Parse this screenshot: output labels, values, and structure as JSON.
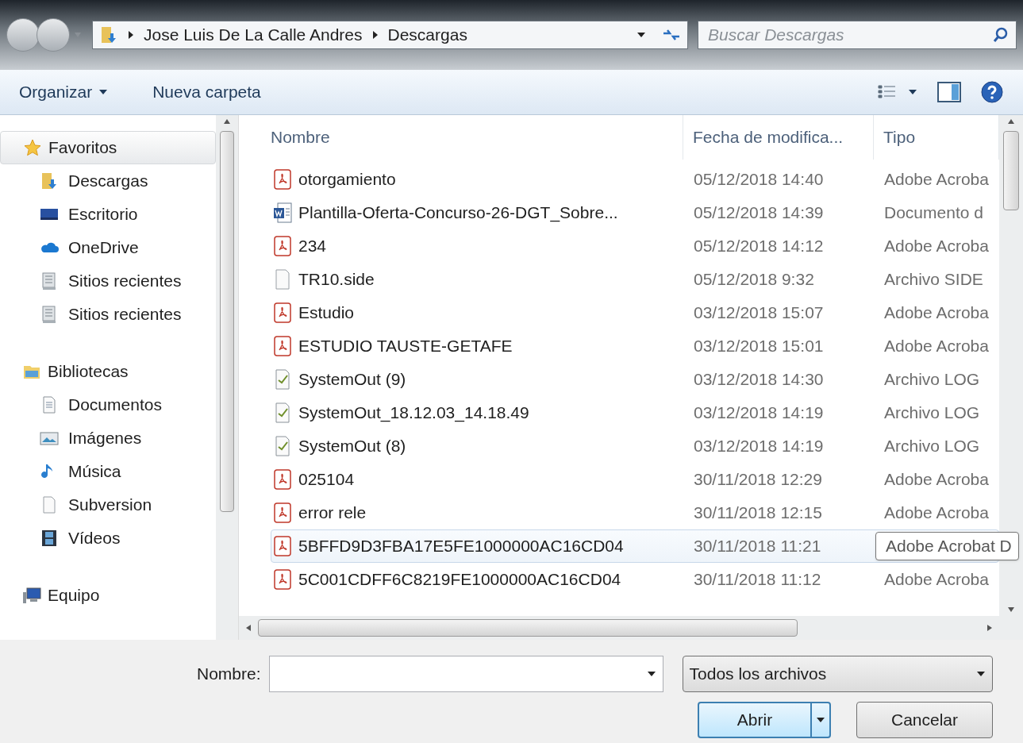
{
  "address_bar": {
    "path": [
      "Jose Luis De La Calle Andres",
      "Descargas"
    ],
    "search_placeholder": "Buscar Descargas"
  },
  "toolbar": {
    "organize": "Organizar",
    "new_folder": "Nueva carpeta"
  },
  "sidebar": {
    "groups": [
      {
        "label": "Favoritos",
        "selected": true,
        "children": [
          {
            "label": "Descargas"
          },
          {
            "label": "Escritorio"
          },
          {
            "label": "OneDrive"
          },
          {
            "label": "Sitios recientes"
          },
          {
            "label": "Sitios recientes"
          }
        ]
      },
      {
        "label": "Bibliotecas",
        "selected": false,
        "children": [
          {
            "label": "Documentos"
          },
          {
            "label": "Imágenes"
          },
          {
            "label": "Música"
          },
          {
            "label": "Subversion"
          },
          {
            "label": "Vídeos"
          }
        ]
      },
      {
        "label": "Equipo",
        "selected": false
      }
    ]
  },
  "table": {
    "columns": [
      "Nombre",
      "Fecha de modifica...",
      "Tipo"
    ],
    "rows": [
      {
        "kind": "pdf",
        "name": "otorgamiento",
        "date": "05/12/2018 14:40",
        "type": "Adobe Acroba",
        "hovered": false
      },
      {
        "kind": "word",
        "name": "Plantilla-Oferta-Concurso-26-DGT_Sobre...",
        "date": "05/12/2018 14:39",
        "type": "Documento d",
        "hovered": false
      },
      {
        "kind": "pdf",
        "name": "234",
        "date": "05/12/2018 14:12",
        "type": "Adobe Acroba",
        "hovered": false
      },
      {
        "kind": "file",
        "name": "TR10.side",
        "date": "05/12/2018 9:32",
        "type": "Archivo SIDE",
        "hovered": false
      },
      {
        "kind": "pdf",
        "name": "Estudio",
        "date": "03/12/2018 15:07",
        "type": "Adobe Acroba",
        "hovered": false
      },
      {
        "kind": "pdf",
        "name": "ESTUDIO TAUSTE-GETAFE",
        "date": "03/12/2018 15:01",
        "type": "Adobe Acroba",
        "hovered": false
      },
      {
        "kind": "log",
        "name": "SystemOut (9)",
        "date": "03/12/2018 14:30",
        "type": "Archivo LOG",
        "hovered": false
      },
      {
        "kind": "log",
        "name": "SystemOut_18.12.03_14.18.49",
        "date": "03/12/2018 14:19",
        "type": "Archivo LOG",
        "hovered": false
      },
      {
        "kind": "log",
        "name": "SystemOut (8)",
        "date": "03/12/2018 14:19",
        "type": "Archivo LOG",
        "hovered": false
      },
      {
        "kind": "pdf",
        "name": "025104",
        "date": "30/11/2018 12:29",
        "type": "Adobe Acroba",
        "hovered": false
      },
      {
        "kind": "pdf",
        "name": "error rele",
        "date": "30/11/2018 12:15",
        "type": "Adobe Acroba",
        "hovered": false
      },
      {
        "kind": "pdf",
        "name": "5BFFD9D3FBA17E5FE1000000AC16CD04",
        "date": "30/11/2018 11:21",
        "type": "Adobe Acrobat D",
        "hovered": true
      },
      {
        "kind": "pdf",
        "name": "5C001CDFF6C8219FE1000000AC16CD04",
        "date": "30/11/2018 11:12",
        "type": "Adobe Acroba",
        "hovered": false
      }
    ]
  },
  "footer": {
    "filename_label": "Nombre:",
    "filter": "Todos los archivos",
    "open_button": "Abrir",
    "cancel_button": "Cancelar"
  }
}
